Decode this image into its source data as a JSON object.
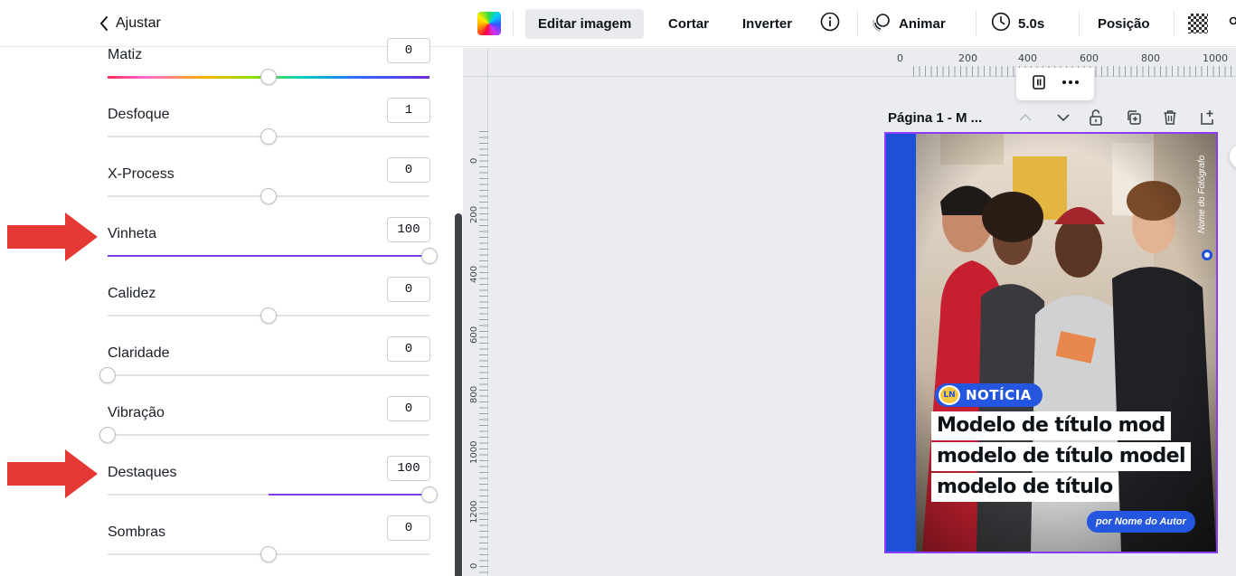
{
  "panel": {
    "back_label": "Ajustar"
  },
  "adjustments": [
    {
      "label": "Matiz",
      "value": "0",
      "level": 50,
      "track": "rainbow"
    },
    {
      "label": "Desfoque",
      "value": "1",
      "level": 50,
      "track": "plain"
    },
    {
      "label": "X-Process",
      "value": "0",
      "level": 50,
      "track": "plain"
    },
    {
      "label": "Vinheta",
      "value": "100",
      "level": 100,
      "track": "fill-from-start"
    },
    {
      "label": "Calidez",
      "value": "0",
      "level": 50,
      "track": "plain"
    },
    {
      "label": "Claridade",
      "value": "0",
      "level": 0,
      "track": "plain"
    },
    {
      "label": "Vibração",
      "value": "0",
      "level": 0,
      "track": "plain"
    },
    {
      "label": "Destaques",
      "value": "100",
      "level": 100,
      "track": "fill-from-center"
    },
    {
      "label": "Sombras",
      "value": "0",
      "level": 50,
      "track": "plain"
    }
  ],
  "toolbar": {
    "edit_image": "Editar imagem",
    "crop": "Cortar",
    "flip": "Inverter",
    "animate": "Animar",
    "duration": "5.0s",
    "position": "Posição"
  },
  "ruler": {
    "top_labels": [
      "0",
      "200",
      "400",
      "600",
      "800",
      "1000"
    ],
    "left_labels": [
      "0",
      "200",
      "400",
      "600",
      "800",
      "1000",
      "1200",
      "0"
    ]
  },
  "page": {
    "label": "Página 1 - M ..."
  },
  "design": {
    "badge_logo": "LN",
    "badge": "NOTÍCIA",
    "headline": [
      "Modelo de título mod",
      "modelo de título model",
      "modelo de título"
    ],
    "author": "por Nome do Autor",
    "photo_credit": "Nome do Fotógrafo"
  },
  "colors": {
    "accent": "#8b3dff",
    "slider_fill": "#7d3cf2",
    "arrow": "#e53935",
    "brand_blue": "#1e4fd8"
  }
}
